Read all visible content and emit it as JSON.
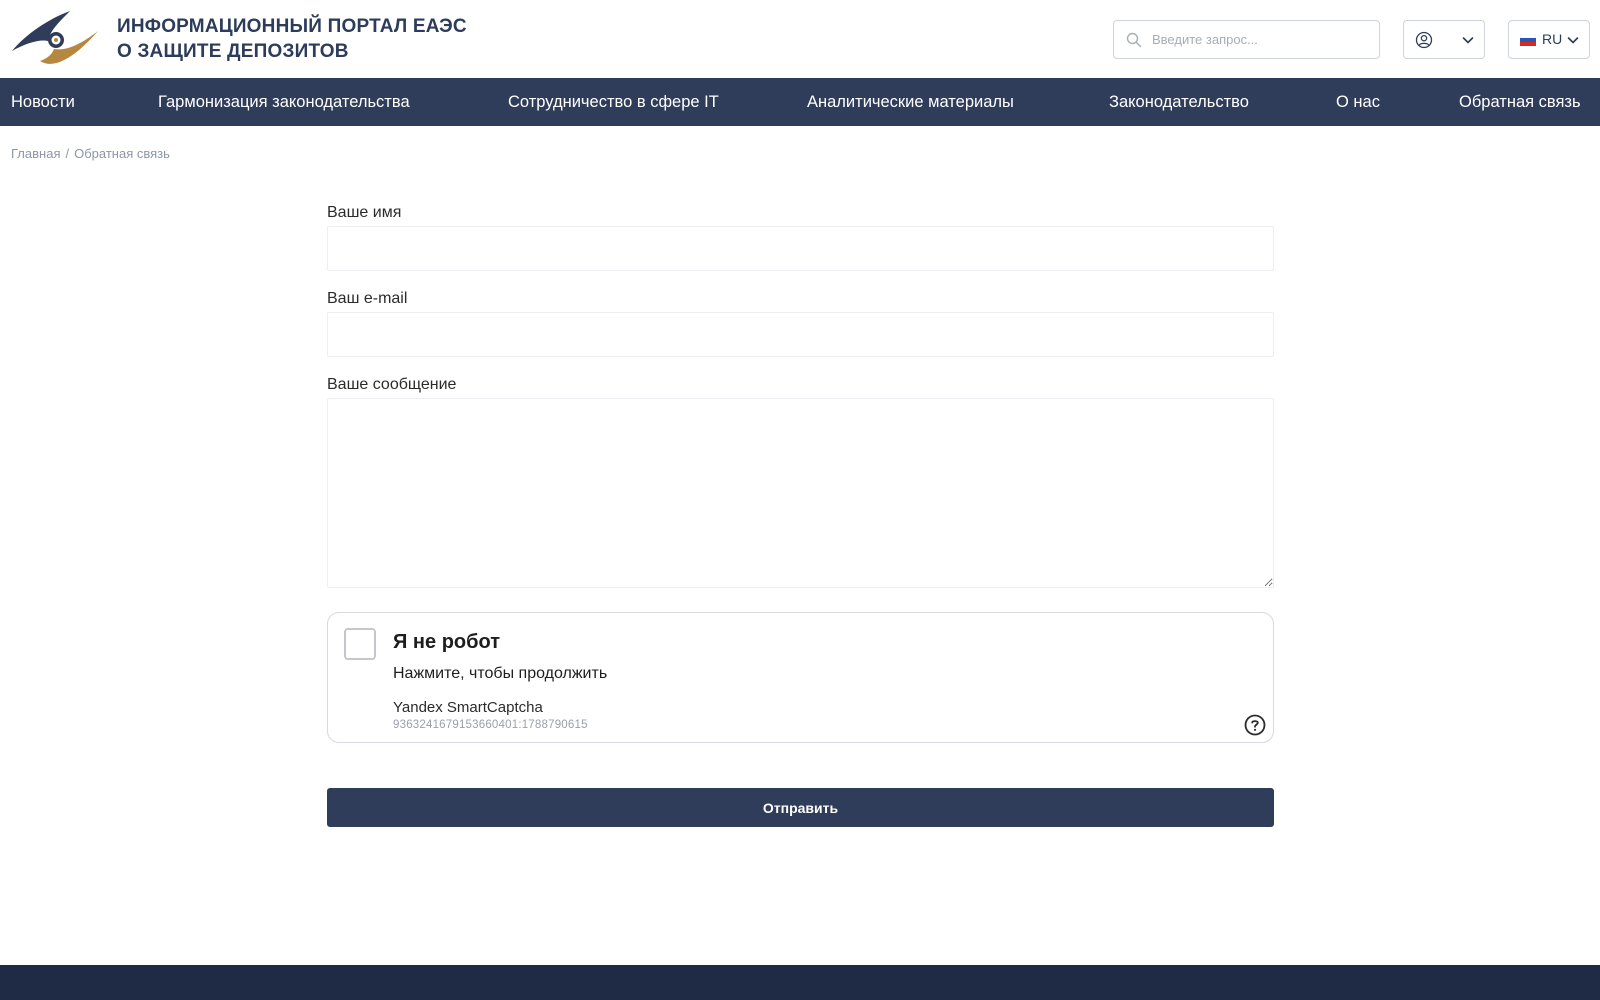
{
  "header": {
    "title_line1": "ИНФОРМАЦИОННЫЙ ПОРТАЛ ЕАЭС",
    "title_line2": "О ЗАЩИТЕ ДЕПОЗИТОВ",
    "logo_icon": "eaeu-logo-icon",
    "search": {
      "placeholder": "Введите запрос...",
      "value": "",
      "icon": "search-icon"
    },
    "user_menu": {
      "icon": "user-circle-icon",
      "chevron": "chevron-down-icon"
    },
    "language": {
      "label": "RU",
      "flag": "russia-flag-icon",
      "chevron": "chevron-down-icon"
    }
  },
  "nav": {
    "items": [
      {
        "label": "Новости"
      },
      {
        "label": "Гармонизация законодательства"
      },
      {
        "label": "Сотрудничество в сфере IT"
      },
      {
        "label": "Аналитические материалы"
      },
      {
        "label": "Законодательство"
      },
      {
        "label": "О нас"
      },
      {
        "label": "Обратная связь"
      }
    ]
  },
  "breadcrumb": {
    "home": "Главная",
    "separator": "/",
    "current": "Обратная связь"
  },
  "form": {
    "name_label": "Ваше имя",
    "name_value": "",
    "email_label": "Ваш e-mail",
    "email_value": "",
    "message_label": "Ваше сообщение",
    "message_value": "",
    "submit_label": "Отправить"
  },
  "captcha": {
    "title": "Я не робот",
    "subtitle": "Нажмите, чтобы продолжить",
    "brand": "Yandex SmartCaptcha",
    "id": "9363241679153660401:1788790615",
    "checked": false,
    "help_icon": "question-circle-icon"
  },
  "colors": {
    "brand_navy": "#2f3c5a",
    "footer_navy": "#1f2a44",
    "logo_gold": "#b5873f",
    "breadcrumb_gray": "#8d96a8"
  }
}
